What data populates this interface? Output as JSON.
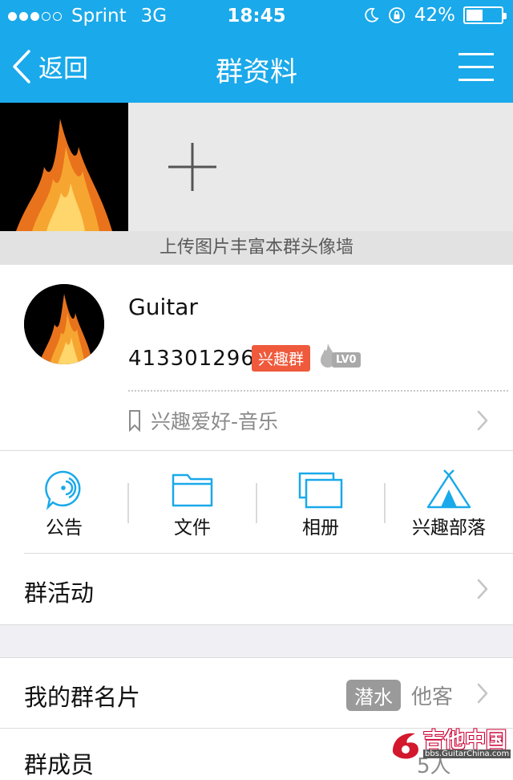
{
  "status_bar": {
    "carrier": "Sprint",
    "network": "3G",
    "time": "18:45",
    "battery": "42%",
    "battery_level": 0.42,
    "signal_bars": 3
  },
  "nav": {
    "back_label": "返回",
    "title": "群资料"
  },
  "photo_wall": {
    "upload_hint": "上传图片丰富本群头像墙"
  },
  "group": {
    "name": "Guitar",
    "id": "413301296",
    "tag": "兴趣群",
    "level": "LV0",
    "category": "兴趣爱好-音乐"
  },
  "functions": [
    {
      "label": "公告",
      "icon": "announcement-icon"
    },
    {
      "label": "文件",
      "icon": "folder-icon"
    },
    {
      "label": "相册",
      "icon": "album-icon"
    },
    {
      "label": "兴趣部落",
      "icon": "tribe-tent-icon"
    }
  ],
  "rows": {
    "activity": "群活动",
    "my_card": "我的群名片",
    "my_card_badge": "潜水",
    "my_card_value": "他客",
    "members": "群成员",
    "members_count": "5人"
  },
  "watermark": {
    "brand": "吉他中国",
    "url": "bbs.GuitarChina.com"
  },
  "colors": {
    "header": "#1aa9ea",
    "tag": "#ef5a3c",
    "icon_blue": "#1aa9ea"
  }
}
